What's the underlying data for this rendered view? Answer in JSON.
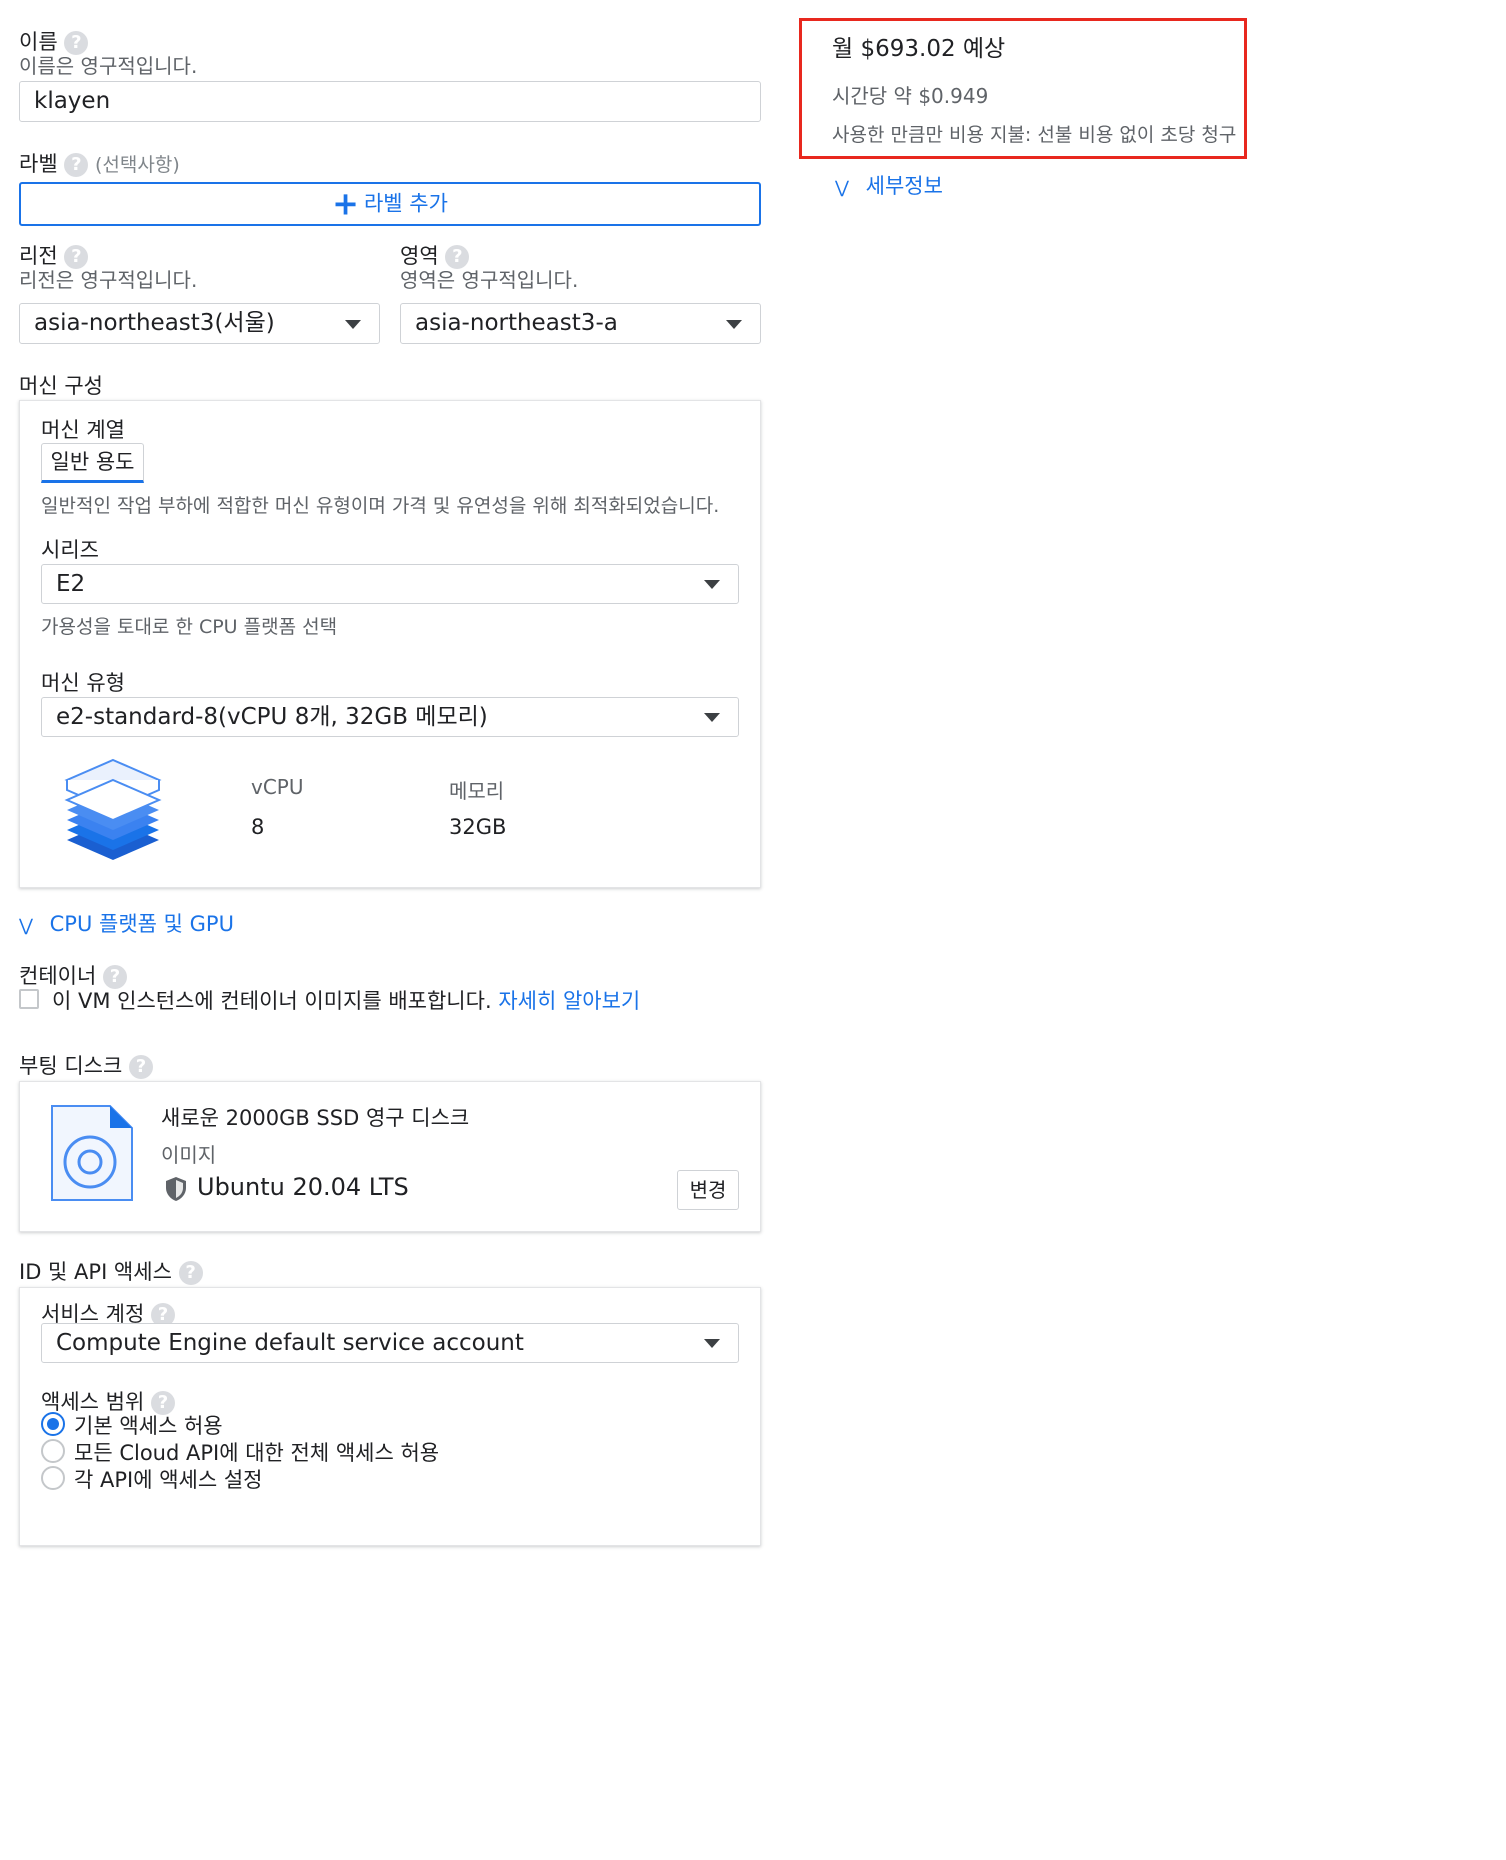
{
  "name": {
    "label": "이름",
    "hint": "이름은 영구적입니다.",
    "value": "klayen"
  },
  "labels": {
    "label": "라벨",
    "optional": "(선택사항)",
    "add_button": "라벨 추가"
  },
  "region": {
    "label": "리전",
    "hint": "리전은 영구적입니다.",
    "value": "asia-northeast3(서울)"
  },
  "zone": {
    "label": "영역",
    "hint": "영역은 영구적입니다.",
    "value": "asia-northeast3-a"
  },
  "machine_config": {
    "title": "머신 구성",
    "family_label": "머신 계열",
    "family_tab": "일반 용도",
    "family_desc": "일반적인 작업 부하에 적합한 머신 유형이며 가격 및 유연성을 위해 최적화되었습니다.",
    "series_label": "시리즈",
    "series_value": "E2",
    "series_hint": "가용성을 토대로 한 CPU 플랫폼 선택",
    "type_label": "머신 유형",
    "type_value": "e2-standard-8(vCPU 8개, 32GB 메모리)",
    "vcpu_label": "vCPU",
    "vcpu_value": "8",
    "memory_label": "메모리",
    "memory_value": "32GB",
    "icon": "stack-layers-icon"
  },
  "cpu_gpu_toggle": "CPU 플랫폼 및 GPU",
  "container": {
    "label": "컨테이너",
    "checkbox_text": "이 VM 인스턴스에 컨테이너 이미지를 배포합니다.",
    "learn_more": "자세히 알아보기",
    "checked": false
  },
  "boot_disk": {
    "label": "부팅 디스크",
    "title": "새로운 2000GB SSD 영구 디스크",
    "image_label": "이미지",
    "image_name": "Ubuntu 20.04 LTS",
    "change_button": "변경",
    "icon": "disk-file-icon"
  },
  "identity": {
    "label": "ID 및 API 액세스",
    "service_account_label": "서비스 계정",
    "service_account_value": "Compute Engine default service account",
    "scope_label": "액세스 범위",
    "scope_options": [
      "기본 액세스 허용",
      "모든 Cloud API에 대한 전체 액세스 허용",
      "각 API에 액세스 설정"
    ],
    "selected_scope": 0
  },
  "pricing": {
    "monthly": "월 $693.02 예상",
    "hourly": "시간당 약 $0.949",
    "note": "사용한 만큼만 비용 지불: 선불 비용 없이 초당 청구",
    "details_toggle": "세부정보",
    "highlight_color": "#e8281e"
  },
  "colors": {
    "accent": "#1a73e8",
    "text": "#202124",
    "muted": "#5f6368"
  }
}
